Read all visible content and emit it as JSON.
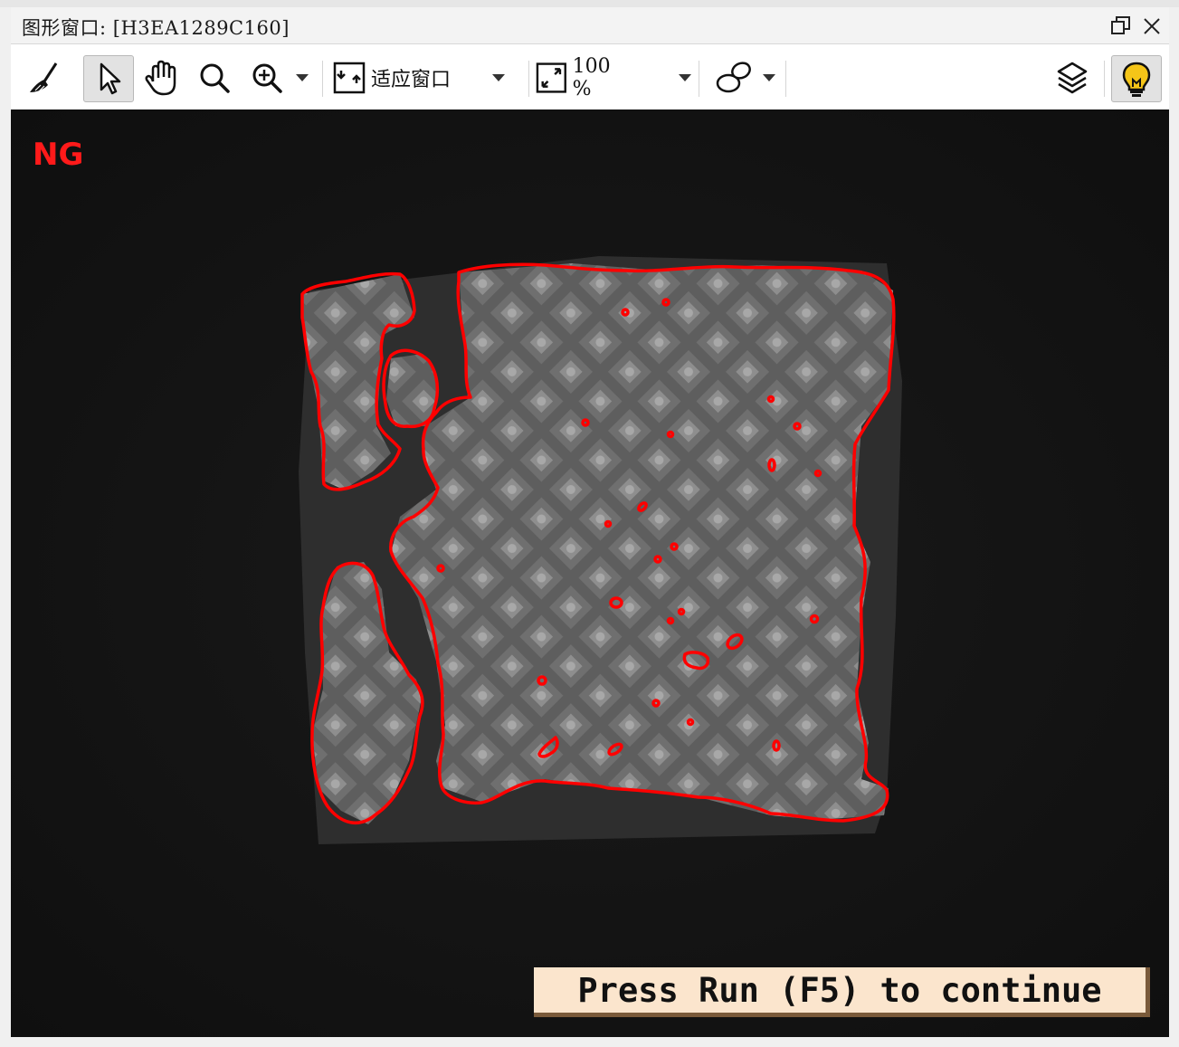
{
  "window": {
    "title": "图形窗口: [H3EA1289C160]",
    "restore_icon": "restore-icon",
    "close_icon": "close-icon"
  },
  "toolbar": {
    "clear_icon": "broom-icon",
    "select_icon": "pointer-icon",
    "pan_icon": "hand-icon",
    "magnifier_icon": "magnifier-icon",
    "zoom_icon": "zoom-in-icon",
    "fit_label": "适应窗口",
    "zoom_value": "100 %",
    "shape_icon": "ellipses-icon",
    "layers_icon": "layers-icon",
    "hint_icon": "lightbulb-icon"
  },
  "canvas": {
    "status_text": "NG",
    "status_color": "#ff1a1a",
    "message": "Press Run (F5) to continue",
    "contour_color": "#ff0000"
  }
}
